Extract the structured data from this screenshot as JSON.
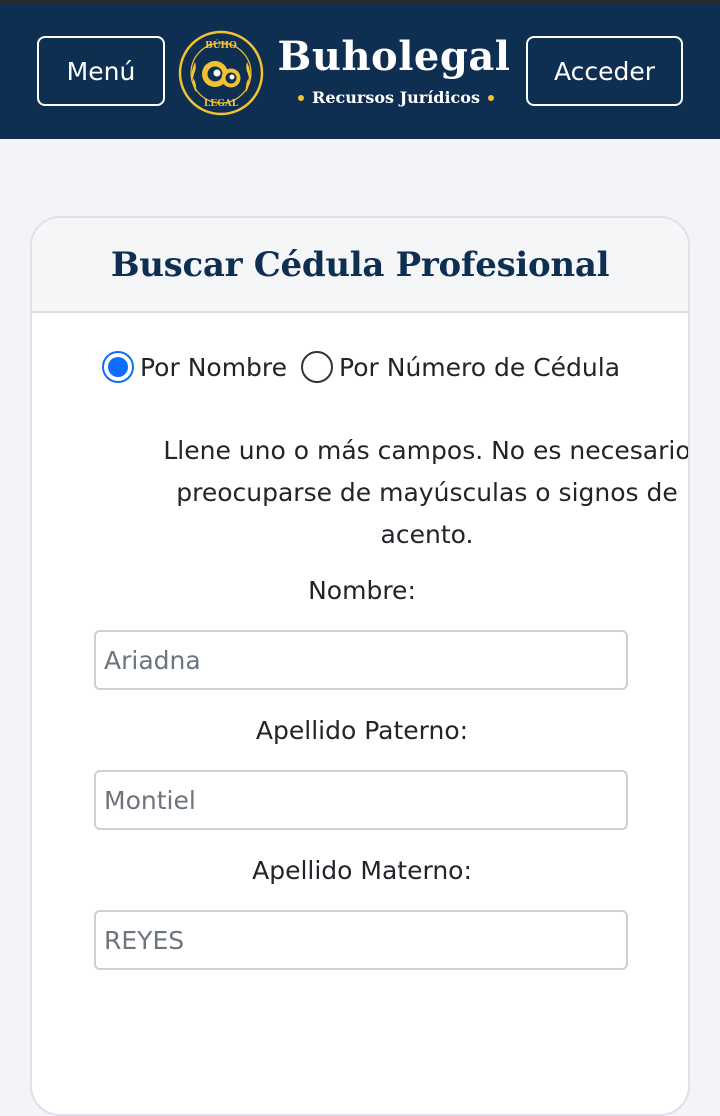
{
  "header": {
    "menu_label": "Menú",
    "login_label": "Acceder",
    "brand_name": "Buholegal",
    "brand_tagline": "Recursos Jurídicos",
    "logo_text_top": "BÚHO",
    "logo_text_bottom": "LEGAL",
    "colors": {
      "background": "#0f2f52",
      "accent": "#f2c230"
    }
  },
  "card": {
    "title": "Buscar Cédula Profesional",
    "search_mode": {
      "options": [
        "Por Nombre",
        "Por Número de Cédula"
      ],
      "selected": "Por Nombre"
    },
    "help_text": "Llene uno o más campos. No es necesario preocuparse de mayúsculas o signos de acento.",
    "fields": [
      {
        "label": "Nombre:",
        "value": "Ariadna"
      },
      {
        "label": "Apellido Paterno:",
        "value": "Montiel"
      },
      {
        "label": "Apellido Materno:",
        "value": "REYES"
      }
    ]
  }
}
